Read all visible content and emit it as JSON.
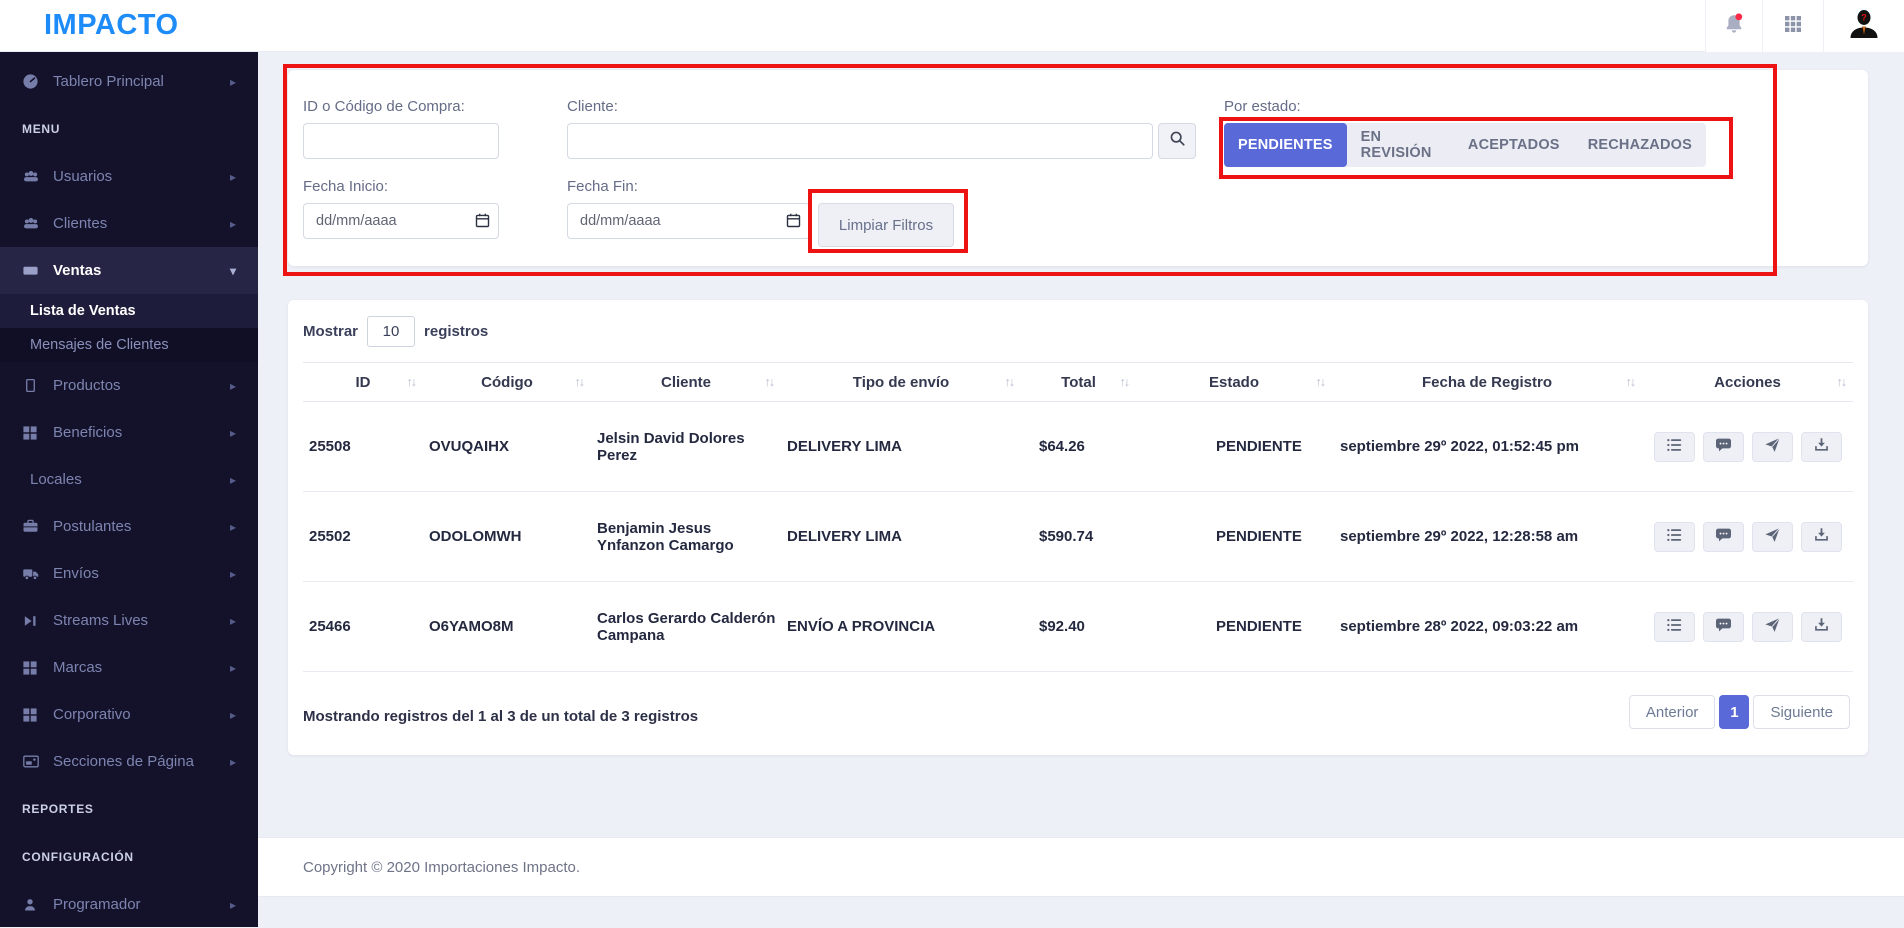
{
  "header": {
    "logo": "IMPACTO",
    "nav_icons": {
      "notifications": "bell-icon",
      "apps": "apps-grid-icon",
      "account": "user-avatar"
    }
  },
  "sidebar": {
    "entries": [
      {
        "kind": "item",
        "name": "tablero-principal",
        "label": "Tablero Principal",
        "icon": "dashboard-icon",
        "chevron": "right"
      },
      {
        "kind": "section",
        "name": "menu",
        "label": "MENU"
      },
      {
        "kind": "item",
        "name": "usuarios",
        "label": "Usuarios",
        "icon": "users-icon",
        "chevron": "right"
      },
      {
        "kind": "item",
        "name": "clientes",
        "label": "Clientes",
        "icon": "users-icon",
        "chevron": "right"
      },
      {
        "kind": "item",
        "name": "ventas",
        "label": "Ventas",
        "icon": "ticket-icon",
        "chevron": "down",
        "active": true
      },
      {
        "kind": "subitem",
        "name": "lista-de-ventas",
        "label": "Lista de Ventas",
        "active": true
      },
      {
        "kind": "subitem",
        "name": "mensajes-de-clientes",
        "label": "Mensajes de Clientes",
        "active": false
      },
      {
        "kind": "item",
        "name": "productos",
        "label": "Productos",
        "icon": "box-icon",
        "chevron": "right"
      },
      {
        "kind": "item",
        "name": "beneficios",
        "label": "Beneficios",
        "icon": "grid-icon",
        "chevron": "right"
      },
      {
        "kind": "item",
        "name": "locales",
        "label": "Locales",
        "icon": null,
        "chevron": "right"
      },
      {
        "kind": "item",
        "name": "postulantes",
        "label": "Postulantes",
        "icon": "briefcase-icon",
        "chevron": "right"
      },
      {
        "kind": "item",
        "name": "envios",
        "label": "Envíos",
        "icon": "truck-icon",
        "chevron": "right"
      },
      {
        "kind": "item",
        "name": "streams-lives",
        "label": "Streams Lives",
        "icon": "stream-icon",
        "chevron": "right"
      },
      {
        "kind": "item",
        "name": "marcas",
        "label": "Marcas",
        "icon": "grid-icon",
        "chevron": "right"
      },
      {
        "kind": "item",
        "name": "corporativo",
        "label": "Corporativo",
        "icon": "grid-icon",
        "chevron": "right"
      },
      {
        "kind": "item",
        "name": "secciones-de-pagina",
        "label": "Secciones de Página",
        "icon": "image-icon",
        "chevron": "right"
      },
      {
        "kind": "section",
        "name": "reportes",
        "label": "REPORTES"
      },
      {
        "kind": "section",
        "name": "configuracion",
        "label": "CONFIGURACIÓN"
      },
      {
        "kind": "item",
        "name": "programador",
        "label": "Programador",
        "icon": "person-icon",
        "chevron": "right"
      }
    ]
  },
  "filters": {
    "id_label": "ID o Código de Compra:",
    "id_value": "",
    "cliente_label": "Cliente:",
    "cliente_value": "",
    "search_icon": "magnifier-icon",
    "estado_label": "Por estado:",
    "estado_tabs": [
      {
        "label": "PENDIENTES",
        "active": true
      },
      {
        "label": "EN REVISIÓN",
        "active": false
      },
      {
        "label": "ACEPTADOS",
        "active": false
      },
      {
        "label": "RECHAZADOS",
        "active": false
      }
    ],
    "fecha_inicio_label": "Fecha Inicio:",
    "fecha_fin_label": "Fecha Fin:",
    "date_placeholder": "dd/mm/aaaa",
    "limpiar_label": "Limpiar Filtros"
  },
  "table": {
    "mostrar_label": "Mostrar",
    "page_size": "10",
    "registros_label": "registros",
    "sort_icon": "↑↓",
    "columns": [
      "ID",
      "Código",
      "Cliente",
      "Tipo de envío",
      "Total",
      "Estado",
      "Fecha de Registro",
      "Acciones"
    ],
    "rows": [
      {
        "id": "25508",
        "codigo": "OVUQAIHX",
        "cliente": "Jelsin David Dolores Perez",
        "tipo_envio": "DELIVERY LIMA",
        "total": "$64.26",
        "estado": "PENDIENTE",
        "fecha": "septiembre 29º 2022, 01:52:45 pm"
      },
      {
        "id": "25502",
        "codigo": "ODOLOMWH",
        "cliente": "Benjamin Jesus Ynfanzon Camargo",
        "tipo_envio": "DELIVERY LIMA",
        "total": "$590.74",
        "estado": "PENDIENTE",
        "fecha": "septiembre 29º 2022, 12:28:58 am"
      },
      {
        "id": "25466",
        "codigo": "O6YAMO8M",
        "cliente": "Carlos Gerardo Calderón Campana",
        "tipo_envio": "ENVÍO A PROVINCIA",
        "total": "$92.40",
        "estado": "PENDIENTE",
        "fecha": "septiembre 28º 2022, 09:03:22 am"
      }
    ],
    "action_icons": [
      "list-icon",
      "chat-icon",
      "send-icon",
      "download-icon"
    ],
    "summary": "Mostrando registros del 1 al 3 de un total de 3 registros",
    "pagination": {
      "prev": "Anterior",
      "current": "1",
      "next": "Siguiente"
    }
  },
  "footer": {
    "copyright": "Copyright © 2020 Importaciones Impacto."
  },
  "colors": {
    "accent": "#5a69d8",
    "annotation": "#ee1313",
    "logo": "#1d8cf8",
    "sidebar_bg": "#13122a"
  }
}
